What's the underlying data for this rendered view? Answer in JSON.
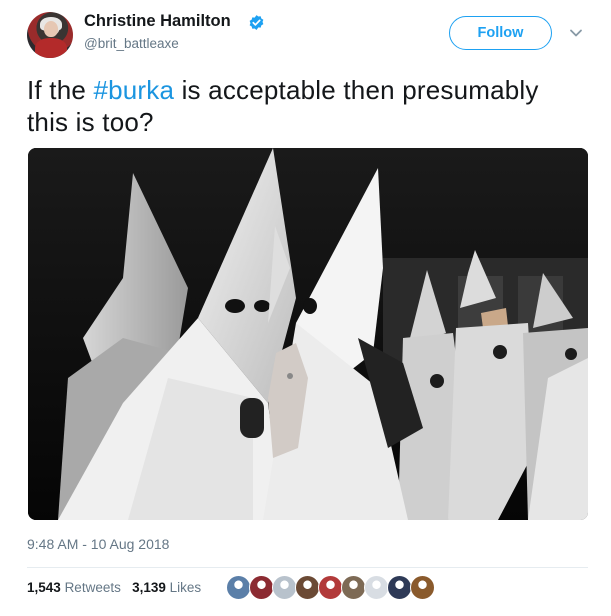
{
  "author": {
    "name": "Christine Hamilton",
    "handle": "@brit_battleaxe",
    "verified": true
  },
  "header": {
    "follow_label": "Follow"
  },
  "tweet": {
    "text_before": "If the ",
    "hashtag": "#burka",
    "text_after": " is acceptable then presumably this is too?"
  },
  "meta": {
    "timestamp": "9:48 AM - 10 Aug 2018"
  },
  "stats": {
    "retweets_count": "1,543",
    "retweets_label": "Retweets",
    "likes_count": "3,139",
    "likes_label": "Likes"
  },
  "likers": [
    {
      "icon": "liker-avatar-1",
      "color": "#5b7fa8"
    },
    {
      "icon": "liker-avatar-2",
      "color": "#8c2b32"
    },
    {
      "icon": "liker-avatar-3",
      "color": "#b8c2cc"
    },
    {
      "icon": "liker-avatar-4",
      "color": "#6b4a35"
    },
    {
      "icon": "liker-avatar-5",
      "color": "#b23a3a"
    },
    {
      "icon": "liker-avatar-6",
      "color": "#7d6a55"
    },
    {
      "icon": "liker-avatar-7",
      "color": "#d8dde3"
    },
    {
      "icon": "liker-avatar-8",
      "color": "#2e3a57"
    },
    {
      "icon": "liker-avatar-9",
      "color": "#8a5a2c"
    }
  ],
  "colors": {
    "accent": "#1da1f2",
    "hashtag": "#1b95e0",
    "secondary_text": "#657786"
  }
}
